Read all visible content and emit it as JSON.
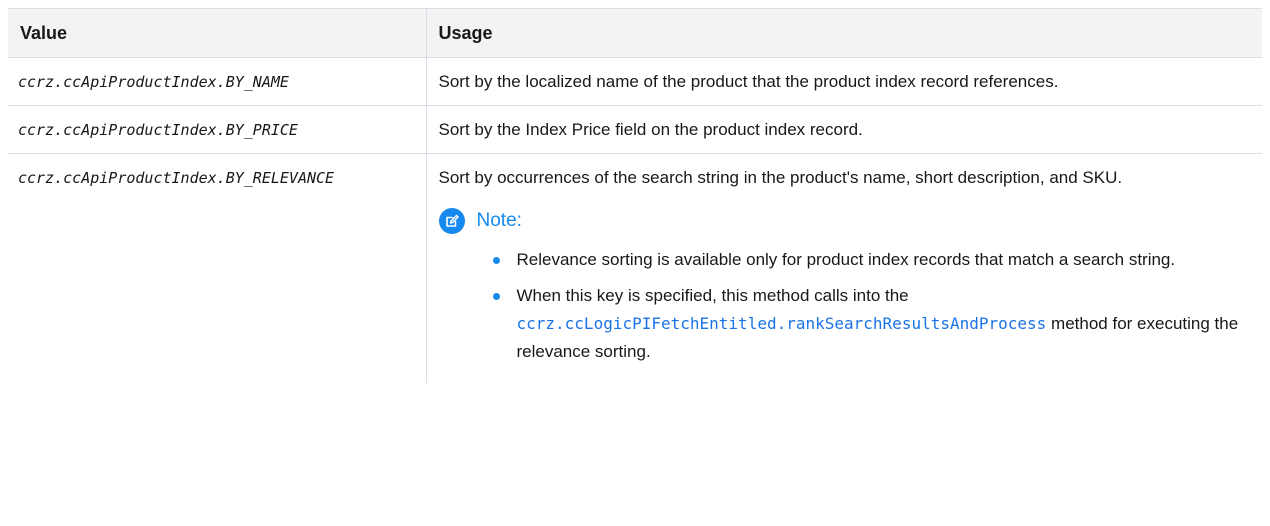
{
  "table": {
    "headers": {
      "value": "Value",
      "usage": "Usage"
    },
    "rows": [
      {
        "value": "ccrz.ccApiProductIndex.BY_NAME",
        "usage": "Sort by the localized name of the product that the product index record references."
      },
      {
        "value": "ccrz.ccApiProductIndex.BY_PRICE",
        "usage": "Sort by the Index Price field on the product index record."
      },
      {
        "value": "ccrz.ccApiProductIndex.BY_RELEVANCE",
        "usage": "Sort by occurrences of the search string in the product's name, short description, and SKU."
      }
    ]
  },
  "note": {
    "icon": "edit-note-icon",
    "title": "Note:",
    "items": {
      "first": "Relevance sorting is available only for product index records that match a search string.",
      "second_before": "When this key is specified, this method calls into the",
      "second_link": "ccrz.ccLogicPIFetchEntitled.rankSearchResultsAndProcess",
      "second_after": "method for executing the relevance sorting."
    }
  },
  "colors": {
    "accent": "#1589ee",
    "header_bg": "#f3f3f3",
    "border": "#d8dde6",
    "link": "#1a73e8"
  }
}
